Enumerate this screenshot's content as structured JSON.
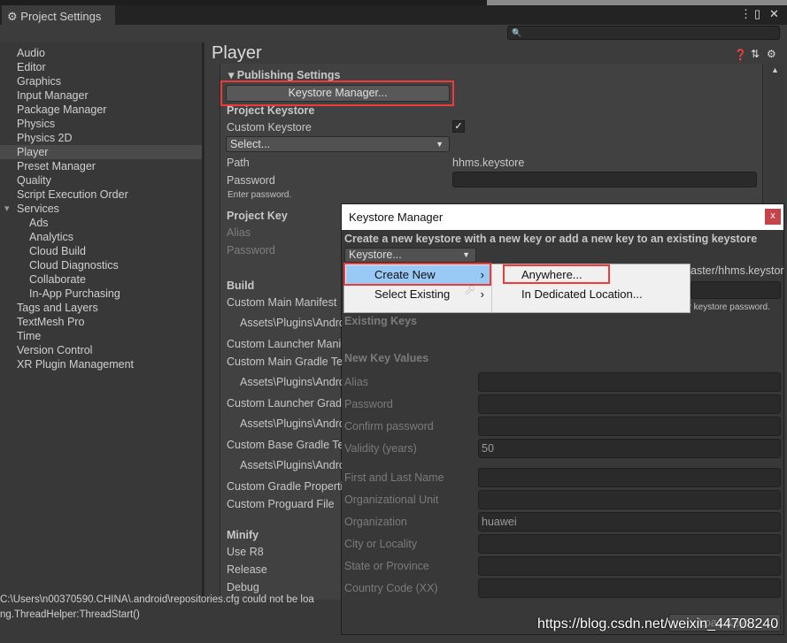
{
  "window": {
    "title": "Project Settings",
    "icons": [
      "gear-icon",
      "more-icon",
      "maximize-icon",
      "close-icon"
    ]
  },
  "search": {
    "placeholder": "",
    "icon": "search-icon"
  },
  "sidebar": {
    "items": [
      {
        "label": "Audio"
      },
      {
        "label": "Editor"
      },
      {
        "label": "Graphics"
      },
      {
        "label": "Input Manager"
      },
      {
        "label": "Package Manager"
      },
      {
        "label": "Physics"
      },
      {
        "label": "Physics 2D"
      },
      {
        "label": "Player",
        "selected": true
      },
      {
        "label": "Preset Manager"
      },
      {
        "label": "Quality"
      },
      {
        "label": "Script Execution Order"
      },
      {
        "label": "Services",
        "expanded": true
      },
      {
        "label": "Ads",
        "sub": true
      },
      {
        "label": "Analytics",
        "sub": true
      },
      {
        "label": "Cloud Build",
        "sub": true
      },
      {
        "label": "Cloud Diagnostics",
        "sub": true
      },
      {
        "label": "Collaborate",
        "sub": true
      },
      {
        "label": "In-App Purchasing",
        "sub": true
      },
      {
        "label": "Tags and Layers"
      },
      {
        "label": "TextMesh Pro"
      },
      {
        "label": "Time"
      },
      {
        "label": "Version Control"
      },
      {
        "label": "XR Plugin Management"
      }
    ]
  },
  "player": {
    "title": "Player",
    "publishing_settings": "Publishing Settings",
    "keystore_manager_button": "Keystore Manager...",
    "project_keystore": "Project Keystore",
    "custom_keystore": "Custom Keystore",
    "custom_keystore_checked": true,
    "select_dropdown": "Select...",
    "path_label": "Path",
    "path_value": "hhms.keystore",
    "password_label": "Password",
    "password_hint": "Enter password.",
    "project_key": "Project Key",
    "alias_label": "Alias",
    "key_password_label": "Password",
    "build": "Build",
    "build_items": [
      "Custom Main Manifest",
      "Assets\\Plugins\\Andro",
      "Custom Launcher Mani",
      "Custom Main Gradle Te",
      "Assets\\Plugins\\Andro",
      "Custom Launcher Grad",
      "Assets\\Plugins\\Andro",
      "Custom Base Gradle Te",
      "Assets\\Plugins\\Andro",
      "Custom Gradle Properti",
      "Custom Proguard File"
    ],
    "minify": "Minify",
    "minify_items": [
      "Use R8",
      "Release",
      "Debug"
    ]
  },
  "console": {
    "lines": [
      "C:\\Users\\n00370590.CHINA\\.android\\repositories.cfg could not be loa",
      "ng.ThreadHelper:ThreadStart()"
    ]
  },
  "dialog": {
    "title": "Keystore Manager",
    "close": "x",
    "description": "Create a new keystore with a new key or add a new key to an existing keystore",
    "keystore_dropdown": "Keystore...",
    "menu": [
      {
        "label": "Create New",
        "highlighted": true
      },
      {
        "label": "Select Existing"
      }
    ],
    "submenu": [
      {
        "label": "Anywhere..."
      },
      {
        "label": "In Dedicated Location..."
      }
    ],
    "path_fragment": "aster/hhms.keystor",
    "password_hint": "Enter keystore password.",
    "existing_keys": "Existing Keys",
    "new_key_values": "New Key Values",
    "fields": [
      {
        "label": "Alias",
        "value": ""
      },
      {
        "label": "Password",
        "value": ""
      },
      {
        "label": "Confirm password",
        "value": ""
      },
      {
        "label": "Validity (years)",
        "value": "50"
      },
      {
        "label": "First and Last Name",
        "value": ""
      },
      {
        "label": "Organizational Unit",
        "value": ""
      },
      {
        "label": "Organization",
        "value": "huawei"
      },
      {
        "label": "City or Locality",
        "value": ""
      },
      {
        "label": "State or Province",
        "value": ""
      },
      {
        "label": "Country Code (XX)",
        "value": ""
      }
    ],
    "load_keys": "Load Keys"
  },
  "watermark": "https://blog.csdn.net/weixin_44708240",
  "colors": {
    "highlight": "#99c9f5",
    "annotation_red": "#f03a3a",
    "close_button": "#c4444a"
  }
}
